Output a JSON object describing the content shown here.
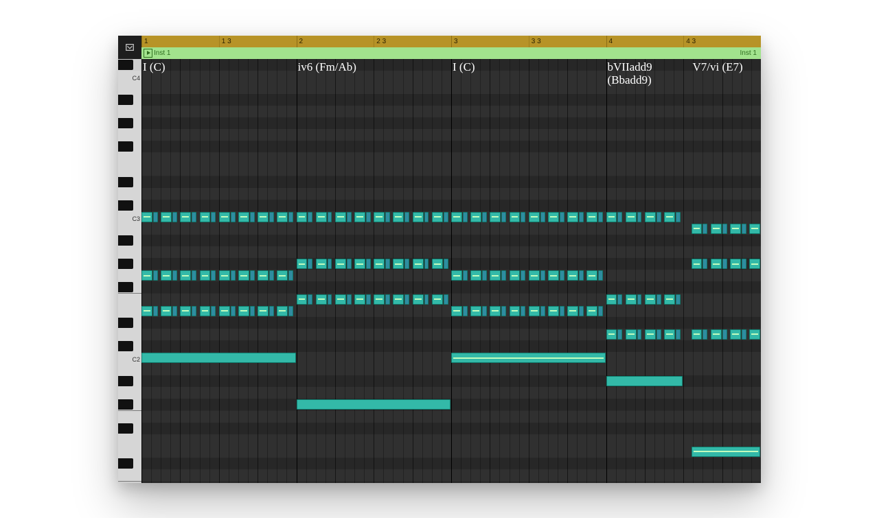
{
  "track": {
    "region_name": "Inst 1"
  },
  "timeline": {
    "bars": 4,
    "labels": [
      {
        "bar": 1,
        "beat": 1,
        "text": "1"
      },
      {
        "bar": 1,
        "beat": 2,
        "text": "1 3",
        "minor": true
      },
      {
        "bar": 2,
        "beat": 1,
        "text": "2"
      },
      {
        "bar": 2,
        "beat": 2,
        "text": "2 3",
        "minor": true
      },
      {
        "bar": 3,
        "beat": 1,
        "text": "3"
      },
      {
        "bar": 3,
        "beat": 2,
        "text": "3 3",
        "minor": true
      },
      {
        "bar": 4,
        "beat": 1,
        "text": "4"
      },
      {
        "bar": 4,
        "beat": 2,
        "text": "4 3",
        "minor": true
      }
    ]
  },
  "overlay_labels": [
    {
      "bar": 1.0,
      "row": 0,
      "text": "I (C)"
    },
    {
      "bar": 2.0,
      "row": 0,
      "text": "iv6 (Fm/Ab)"
    },
    {
      "bar": 3.0,
      "row": 0,
      "text": "I (C)"
    },
    {
      "bar": 4.0,
      "row": 0,
      "text": "bVIIadd9\n(Bbadd9)"
    },
    {
      "bar": 4.55,
      "row": 0,
      "text": "V7/vi (E7)"
    }
  ],
  "piano": {
    "top_midi": 73,
    "bottom_midi": 38,
    "row_h": 17.1,
    "c_labels": [
      {
        "midi": 72,
        "text": "C4"
      },
      {
        "midi": 60,
        "text": "C3"
      },
      {
        "midi": 48,
        "text": "C2"
      }
    ],
    "black_pcs": [
      1,
      3,
      6,
      8,
      10
    ]
  },
  "colors": {
    "note": "#33b9a8",
    "note_dim": "#2f8ca0",
    "ruler": "#b79327",
    "region": "#a2e38d"
  },
  "chart_data": {
    "type": "table",
    "title": "MIDI Piano Roll — 4 bars, key of C",
    "chords_per_bar": [
      "I (C)",
      "iv6 (Fm/Ab)",
      "I (C)",
      "bVIIadd9 (Bbadd9) → V7/vi (E7) on beat 3"
    ],
    "bass_notes": [
      {
        "pitch": "C2",
        "midi": 48,
        "start_bar": 1.0,
        "end_bar": 2.0
      },
      {
        "pitch": "Ab1",
        "midi": 44,
        "start_bar": 2.0,
        "end_bar": 3.0
      },
      {
        "pitch": "C2",
        "midi": 48,
        "start_bar": 3.0,
        "end_bar": 4.0
      },
      {
        "pitch": "Bb1",
        "midi": 46,
        "start_bar": 4.0,
        "end_bar": 4.5
      },
      {
        "pitch": "E1",
        "midi": 40,
        "start_bar": 4.55,
        "end_bar": 5.0
      }
    ],
    "comping_pattern_per_bar": "8th-note pairs on beats 1,1.5,2,2.5,3,3.5,4,4.5 — each pair: long 8th (with velocity accent) then short 16th (dimmer)",
    "chord_voicings": {
      "bar1_I_C": [
        "E2 (52)",
        "G2 (55)",
        "C3 (60)"
      ],
      "bar2_iv6_FmAb": [
        "F2 (53)",
        "Ab2 (56)",
        "C3 (60)"
      ],
      "bar3_I_C": [
        "E2 (52)",
        "G2 (55)",
        "C3 (60)"
      ],
      "bar4a_bVIIadd9": [
        "D2 (50)",
        "F2 (53)",
        "C3 (60)"
      ],
      "bar4b_V7vi_E7": [
        "D2 (50)",
        "G#2 (56)",
        "B2 (59)"
      ]
    },
    "time_signature": "4/4",
    "grid_subdivision": "1/16"
  },
  "notes": []
}
